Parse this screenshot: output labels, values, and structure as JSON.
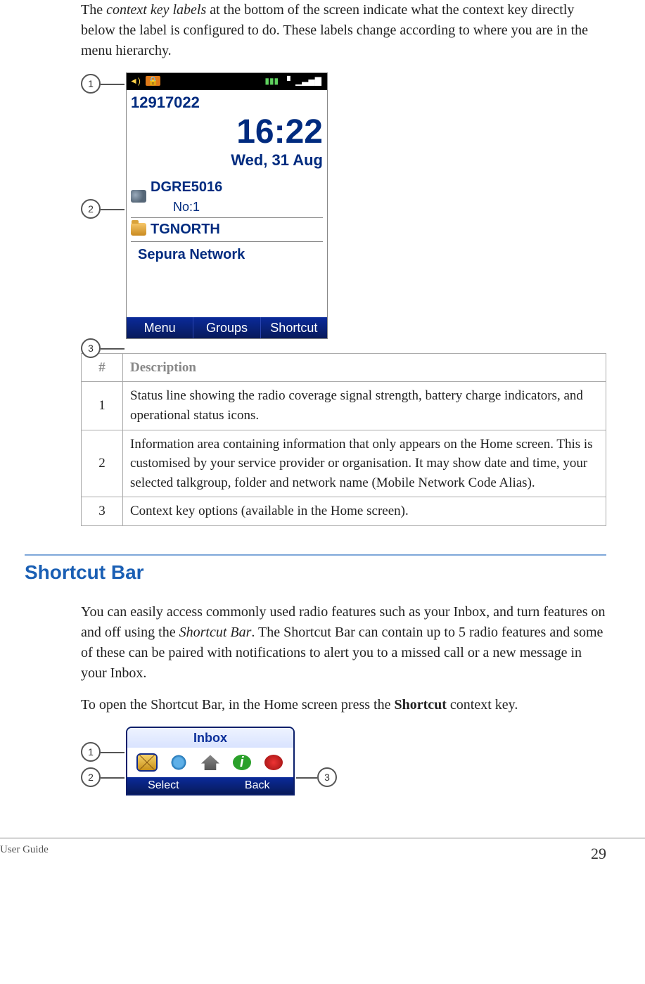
{
  "intro_para_html": "The <em>context key labels</em> at the bottom of the screen indicate what the context key directly below the label is configured to do. These labels change according to where you are in the menu hierarchy.",
  "phone": {
    "callouts": {
      "c1": "1",
      "c2": "2",
      "c3": "3"
    },
    "issi": "12917022",
    "time": "16:22",
    "date": "Wed, 31 Aug",
    "talkgroup": "DGRE5016",
    "talkgroup_no": "No:1",
    "folder": "TGNORTH",
    "network": "Sepura Network",
    "soft": {
      "left": "Menu",
      "mid": "Groups",
      "right": "Shortcut"
    }
  },
  "table": {
    "head_num": "#",
    "head_desc": "Description",
    "rows": [
      {
        "n": "1",
        "d": "Status line showing the radio coverage signal strength, battery charge indicators, and operational status icons."
      },
      {
        "n": "2",
        "d": "Information area containing information that only appears on the Home screen. This is customised by your service provider or organisation. It may show date and time, your selected talkgroup, folder and network name (Mobile Network Code Alias)."
      },
      {
        "n": "3",
        "d": "Context key options (available in the Home screen)."
      }
    ]
  },
  "section_heading": "Shortcut Bar",
  "para2_html": "You can easily access commonly used radio features such as your Inbox, and turn features on and off using the <em>Shortcut Bar</em>. The Shortcut Bar can contain up to 5 radio features and some of these can be paired with notifications to alert you to a missed call or a new message in your Inbox.",
  "para3_html": "To open the Shortcut Bar, in the Home screen press the <strong>Shortcut</strong> context key.",
  "shortcut": {
    "title": "Inbox",
    "soft_left": "Select",
    "soft_right": "Back",
    "callouts": {
      "c1": "1",
      "c2": "2",
      "c3": "3"
    }
  },
  "footer": {
    "left": "User Guide",
    "page": "29"
  }
}
